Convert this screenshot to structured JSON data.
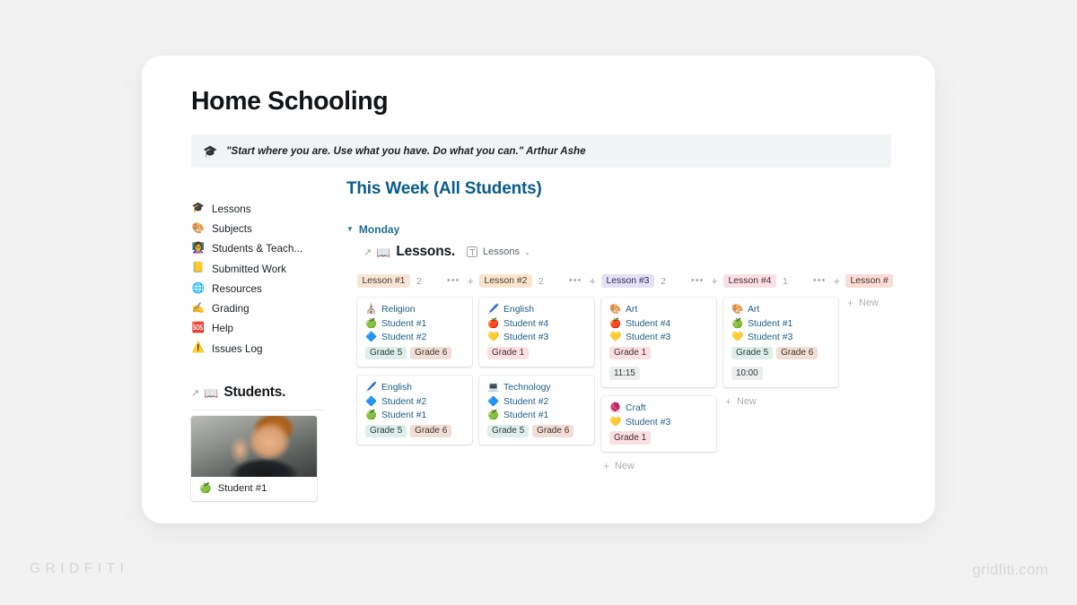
{
  "page": {
    "title": "Home Schooling",
    "callout": {
      "icon": "graduation-cap-emoji",
      "icon_glyph": "🎓",
      "text": "\"Start where you are. Use what you have. Do what you can.\" Arthur Ashe"
    }
  },
  "sidebar": {
    "items": [
      {
        "label": "Lessons",
        "icon": "graduation-cap-emoji",
        "glyph": "🎓"
      },
      {
        "label": "Subjects",
        "icon": "palette-emoji",
        "glyph": "🎨"
      },
      {
        "label": "Students & Teach...",
        "icon": "teacher-emoji",
        "glyph": "👩‍🏫"
      },
      {
        "label": "Submitted Work",
        "icon": "folder-emoji",
        "glyph": "📒"
      },
      {
        "label": "Resources",
        "icon": "globe-emoji",
        "glyph": "🌐"
      },
      {
        "label": "Grading",
        "icon": "pencil-emoji",
        "glyph": "✍️"
      },
      {
        "label": "Help",
        "icon": "sos-emoji",
        "glyph": "🆘"
      },
      {
        "label": "Issues Log",
        "icon": "warning-emoji",
        "glyph": "⚠️"
      }
    ]
  },
  "students_section": {
    "arrow": "↗",
    "icon": "books-emoji",
    "icon_glyph": "📖",
    "title": "Students.",
    "card": {
      "emoji": "🍏",
      "name": "Student #1"
    }
  },
  "main": {
    "view_title": "This Week (All Students)",
    "group": {
      "caret": "▼",
      "label": "Monday"
    },
    "database": {
      "arrow": "↗",
      "icon": "books-emoji",
      "icon_glyph": "📖",
      "title": "Lessons.",
      "chip_label": "Lessons",
      "chip_caret": "⌄"
    },
    "columns": [
      {
        "name": "Lesson #1",
        "count": "2",
        "badge_bg": "#f7e5d6",
        "badge_color": "#4a3b2e",
        "dots": "•••",
        "plus": "+",
        "cards": [
          {
            "lines": [
              {
                "emoji": "⛪",
                "text": "Religion"
              },
              {
                "emoji": "🍏",
                "text": "Student #1"
              },
              {
                "emoji": "🔷",
                "text": "Student #2"
              }
            ],
            "tags": [
              {
                "label": "Grade 5",
                "bg": "#dfeeea",
                "color": "#2b3b38"
              },
              {
                "label": "Grade 6",
                "bg": "#f2ded6",
                "color": "#40302a"
              }
            ],
            "time": null
          },
          {
            "lines": [
              {
                "emoji": "🖊️",
                "text": "English"
              },
              {
                "emoji": "🔷",
                "text": "Student #2"
              },
              {
                "emoji": "🍏",
                "text": "Student #1"
              }
            ],
            "tags": [
              {
                "label": "Grade 5",
                "bg": "#dfeeea",
                "color": "#2b3b38"
              },
              {
                "label": "Grade 6",
                "bg": "#f2ded6",
                "color": "#40302a"
              }
            ],
            "time": null
          }
        ],
        "show_new": false,
        "new_label": "New"
      },
      {
        "name": "Lesson #2",
        "count": "2",
        "badge_bg": "#f9e4cf",
        "badge_color": "#4a3b2e",
        "dots": "•••",
        "plus": "+",
        "cards": [
          {
            "lines": [
              {
                "emoji": "🖊️",
                "text": "English"
              },
              {
                "emoji": "🍎",
                "text": "Student #4"
              },
              {
                "emoji": "💛",
                "text": "Student #3"
              }
            ],
            "tags": [
              {
                "label": "Grade 1",
                "bg": "#fadfe3",
                "color": "#47292e"
              }
            ],
            "time": null
          },
          {
            "lines": [
              {
                "emoji": "💻",
                "text": "Technology"
              },
              {
                "emoji": "🔷",
                "text": "Student #2"
              },
              {
                "emoji": "🍏",
                "text": "Student #1"
              }
            ],
            "tags": [
              {
                "label": "Grade 5",
                "bg": "#dfeeea",
                "color": "#2b3b38"
              },
              {
                "label": "Grade 6",
                "bg": "#f2ded6",
                "color": "#40302a"
              }
            ],
            "time": null
          }
        ],
        "show_new": false,
        "new_label": "New"
      },
      {
        "name": "Lesson #3",
        "count": "2",
        "badge_bg": "#e3e0f7",
        "badge_color": "#322c52",
        "dots": "•••",
        "plus": "+",
        "cards": [
          {
            "lines": [
              {
                "emoji": "🎨",
                "text": "Art"
              },
              {
                "emoji": "🍎",
                "text": "Student #4"
              },
              {
                "emoji": "💛",
                "text": "Student #3"
              }
            ],
            "tags": [
              {
                "label": "Grade 1",
                "bg": "#fadfe3",
                "color": "#47292e"
              }
            ],
            "time": "11:15"
          },
          {
            "lines": [
              {
                "emoji": "🧶",
                "text": "Craft"
              },
              {
                "emoji": "💛",
                "text": "Student #3"
              }
            ],
            "tags": [
              {
                "label": "Grade 1",
                "bg": "#fadfe3",
                "color": "#47292e"
              }
            ],
            "time": null
          }
        ],
        "show_new": true,
        "new_label": "New"
      },
      {
        "name": "Lesson #4",
        "count": "1",
        "badge_bg": "#fbdfe6",
        "badge_color": "#4a2b34",
        "dots": "•••",
        "plus": "+",
        "cards": [
          {
            "lines": [
              {
                "emoji": "🎨",
                "text": "Art"
              },
              {
                "emoji": "🍏",
                "text": "Student #1"
              },
              {
                "emoji": "💛",
                "text": "Student #3"
              }
            ],
            "tags": [
              {
                "label": "Grade 5",
                "bg": "#dfeeea",
                "color": "#2b3b38"
              },
              {
                "label": "Grade 6",
                "bg": "#f2ded6",
                "color": "#40302a"
              }
            ],
            "time": "10:00"
          }
        ],
        "show_new": true,
        "new_label": "New"
      },
      {
        "name": "Lesson #",
        "count": "",
        "badge_bg": "#fbdcd6",
        "badge_color": "#4a2f28",
        "dots": "",
        "plus": "",
        "cards": [],
        "show_new": true,
        "new_label": "New"
      }
    ]
  },
  "watermark": {
    "left": "GRIDFITI",
    "right": "gridfiti.com"
  }
}
